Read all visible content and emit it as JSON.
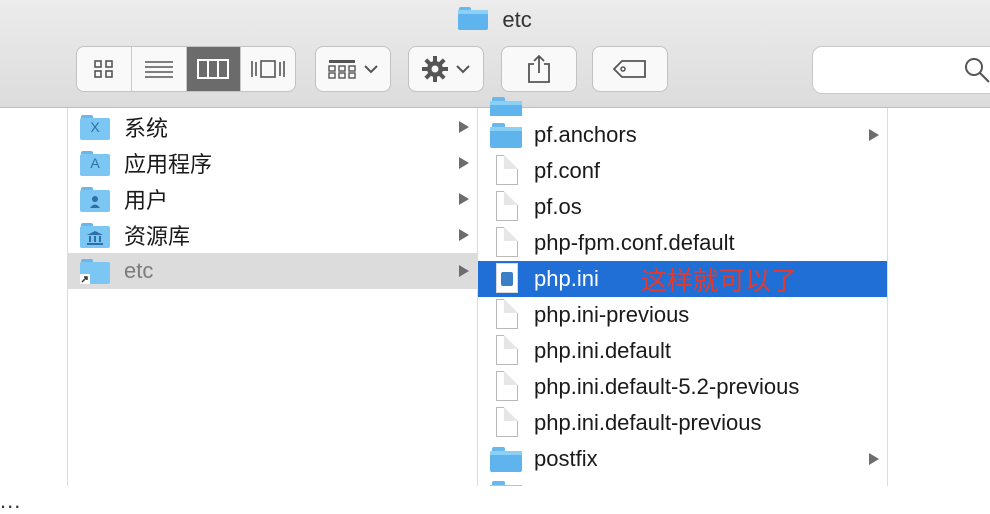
{
  "window": {
    "title": "etc"
  },
  "toolbar": {
    "view_buttons": [
      "icon-view",
      "list-view",
      "column-view",
      "cover-flow-view"
    ],
    "active_view": "column-view",
    "arrange_icon": "grid-arrange-icon",
    "action_icon": "gear-icon",
    "share_icon": "share-icon",
    "tag_icon": "tag-icon",
    "search_icon": "search-icon"
  },
  "sidebar": {
    "overflow": "..."
  },
  "column2": {
    "items": [
      {
        "label": "系统",
        "icon": "system-folder-icon",
        "glyph": "X",
        "has_children": true
      },
      {
        "label": "应用程序",
        "icon": "applications-folder-icon",
        "glyph": "A",
        "has_children": true
      },
      {
        "label": "用户",
        "icon": "users-folder-icon",
        "glyph": "👤",
        "has_children": true
      },
      {
        "label": "资源库",
        "icon": "library-folder-icon",
        "glyph": "🏛",
        "has_children": true
      },
      {
        "label": "etc",
        "icon": "alias-folder-icon",
        "glyph": "",
        "has_children": true,
        "state": "inactive-selected"
      }
    ]
  },
  "column3": {
    "items": [
      {
        "label": "pf.anchors",
        "type": "folder",
        "has_children": true
      },
      {
        "label": "pf.conf",
        "type": "file"
      },
      {
        "label": "pf.os",
        "type": "file"
      },
      {
        "label": "php-fpm.conf.default",
        "type": "file"
      },
      {
        "label": "php.ini",
        "type": "php-file",
        "selected": true
      },
      {
        "label": "php.ini-previous",
        "type": "file"
      },
      {
        "label": "php.ini.default",
        "type": "file"
      },
      {
        "label": "php.ini.default-5.2-previous",
        "type": "file"
      },
      {
        "label": "php.ini.default-previous",
        "type": "file"
      },
      {
        "label": "postfix",
        "type": "folder",
        "has_children": true
      }
    ],
    "annotation": "这样就可以了"
  },
  "colors": {
    "selection": "#1f6fd6",
    "inactive_selection": "#dcdcdc",
    "annotation": "#e43a2c",
    "folder": "#5fb4ee"
  }
}
